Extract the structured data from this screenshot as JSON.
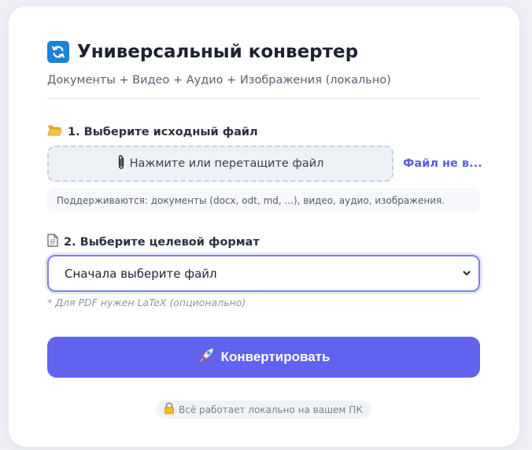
{
  "header": {
    "title": "Универсальный конвертер",
    "subtitle": "Документы + Видео + Аудио + Изображения (локально)"
  },
  "step1": {
    "label": "1. Выберите исходный файл",
    "dropzone_text": "Нажмите или перетащите файл",
    "file_status": "Файл не в...",
    "hint": "Поддерживаются: документы (docx, odt, md, ...), видео, аудио, изображения."
  },
  "step2": {
    "label": "2. Выберите целевой формат",
    "select_value": "Сначала выберите файл",
    "note": "* Для PDF нужен LaTeX (опционально)"
  },
  "action": {
    "convert_label": "Конвертировать"
  },
  "footer": {
    "badge_text": "Всё работает локально на вашем ПК"
  },
  "icons": {
    "title": "refresh-icon",
    "step1": "folder-icon",
    "dropzone": "paperclip-icon",
    "step2": "document-icon",
    "convert": "rocket-icon",
    "badge": "lock-icon",
    "select": "chevron-down-icon"
  },
  "colors": {
    "accent": "#6163ee",
    "link": "#5b5fe0",
    "title_icon_bg": "#1a82d8"
  }
}
